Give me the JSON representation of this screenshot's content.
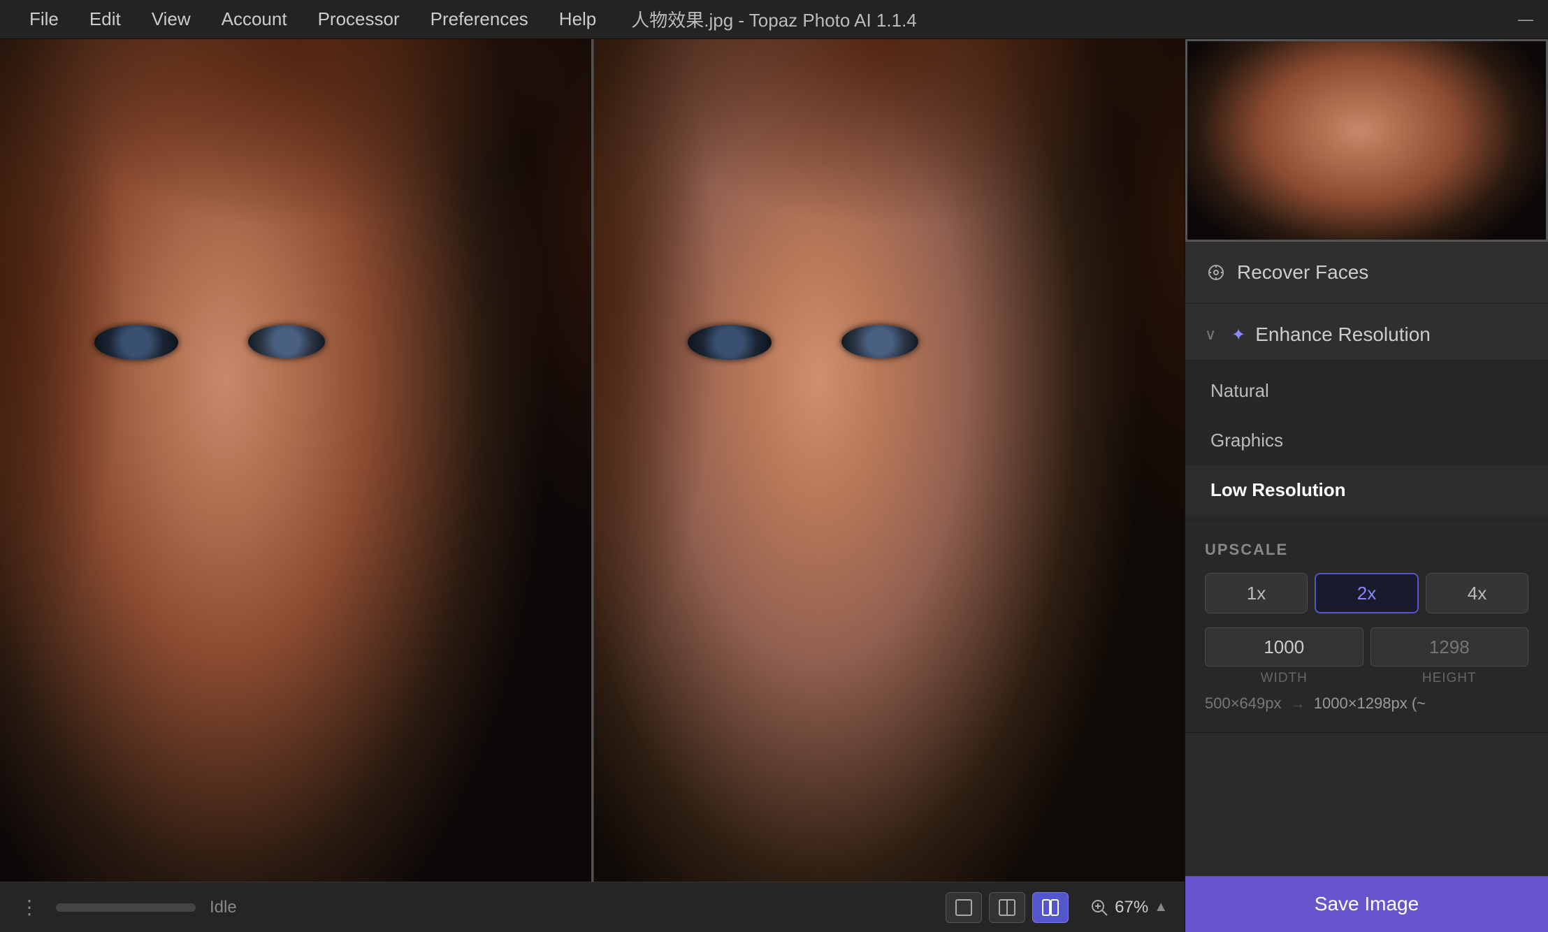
{
  "titlebar": {
    "title": "人物效果.jpg - Topaz Photo AI 1.1.4",
    "menu": {
      "file": "File",
      "edit": "Edit",
      "view": "View",
      "account": "Account",
      "processor": "Processor",
      "preferences": "Preferences",
      "help": "Help"
    },
    "minimize": "—"
  },
  "bottombar": {
    "status": "Idle",
    "zoom": "67%",
    "view_single": "□",
    "view_split_h": "⊡",
    "view_split_v": "⊞"
  },
  "rightpanel": {
    "recover_faces": {
      "title": "Recover Faces",
      "icon": "◎"
    },
    "enhance_resolution": {
      "title": "Enhance Resolution",
      "icon": "✦",
      "chevron": "∨",
      "models": [
        {
          "id": "natural",
          "label": "Natural",
          "selected": false
        },
        {
          "id": "graphics",
          "label": "Graphics",
          "selected": false
        },
        {
          "id": "low_resolution",
          "label": "Low Resolution",
          "selected": true
        }
      ]
    },
    "upscale": {
      "label": "UPSCALE",
      "buttons": [
        {
          "id": "1x",
          "label": "1x",
          "active": false
        },
        {
          "id": "2x",
          "label": "2x",
          "active": true
        },
        {
          "id": "4x",
          "label": "4x",
          "active": false
        }
      ],
      "width_value": "1000",
      "width_label": "WIDTH",
      "height_label": "HEIGHT",
      "resolution_before": "500×649px",
      "resolution_arrow": "→",
      "resolution_after": "1000×1298px (~"
    },
    "save_button": "Save Image"
  }
}
